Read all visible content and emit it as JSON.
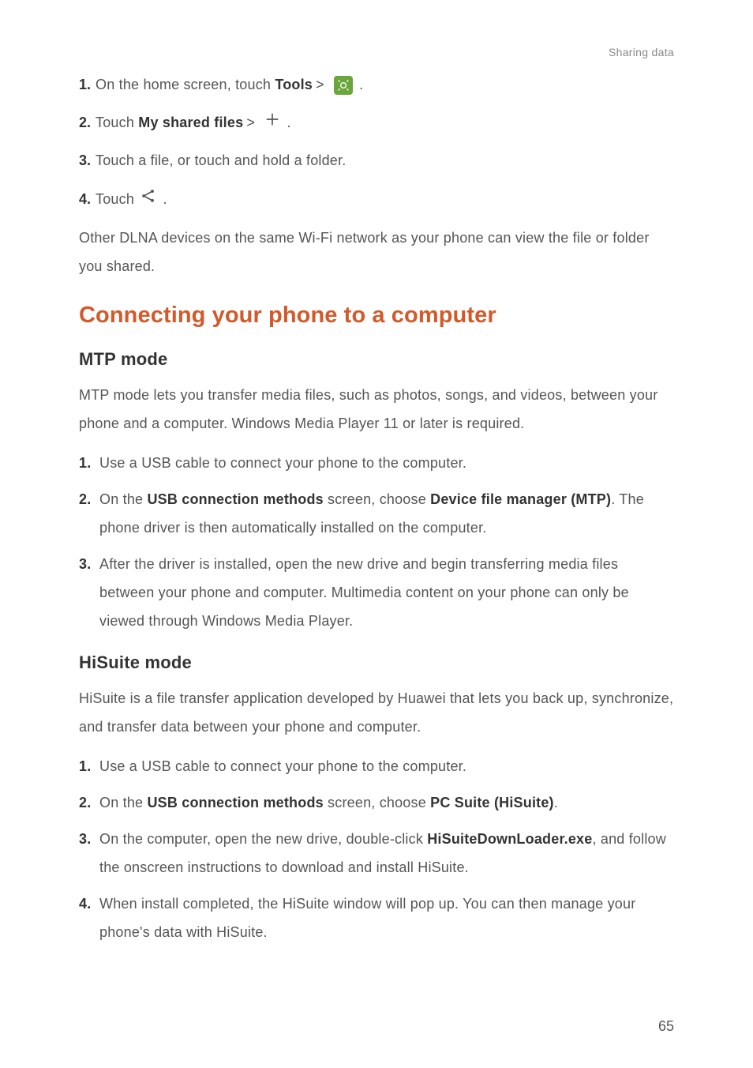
{
  "header": {
    "section": "Sharing data"
  },
  "top_steps": {
    "s1": {
      "num": "1.",
      "pre": "On the home screen, touch ",
      "bold": "Tools",
      "gt": ">",
      "post": "."
    },
    "s2": {
      "num": "2.",
      "pre": "Touch ",
      "bold": "My shared files",
      "gt": ">",
      "post": "."
    },
    "s3": {
      "num": "3.",
      "txt": "Touch a file, or touch and hold a folder."
    },
    "s4": {
      "num": "4.",
      "pre": "Touch ",
      "post": "."
    }
  },
  "para1": "Other DLNA devices on the same Wi-Fi network as your phone can view the file or folder you shared.",
  "h2": "Connecting your phone to a computer",
  "mtp": {
    "title": "MTP  mode",
    "intro": "MTP mode lets you transfer media files, such as photos, songs, and videos, between your phone and a computer. Windows Media Player 11 or later is required.",
    "s1": {
      "num": "1.",
      "txt": "Use a USB cable to connect your phone to the computer."
    },
    "s2": {
      "num": "2.",
      "pre": "On the ",
      "b1": "USB connection methods",
      "mid": " screen, choose ",
      "b2": "Device file manager (MTP)",
      "post": ". The phone driver is then automatically installed on the computer."
    },
    "s3": {
      "num": "3.",
      "txt": "After the driver is installed, open the new drive and begin transferring media files between your phone and computer. Multimedia content on your phone can only be viewed through Windows Media Player."
    }
  },
  "hisuite": {
    "title": "HiSuite  mode",
    "intro": "HiSuite is a file transfer application developed by Huawei that lets you back up, synchronize, and transfer data between your phone and computer.",
    "s1": {
      "num": "1.",
      "txt": "Use a USB cable to connect your phone to the computer."
    },
    "s2": {
      "num": "2.",
      "pre": "On the ",
      "b1": "USB connection methods",
      "mid": " screen, choose ",
      "b2": "PC Suite (HiSuite)",
      "post": "."
    },
    "s3": {
      "num": "3.",
      "pre": "On the computer, open the new drive, double-click ",
      "b1": "HiSuiteDownLoader.exe",
      "post": ", and follow the onscreen instructions to download and install HiSuite."
    },
    "s4": {
      "num": "4.",
      "txt": "When install completed, the HiSuite window will pop up. You can then manage your phone's data with HiSuite."
    }
  },
  "page": "65"
}
